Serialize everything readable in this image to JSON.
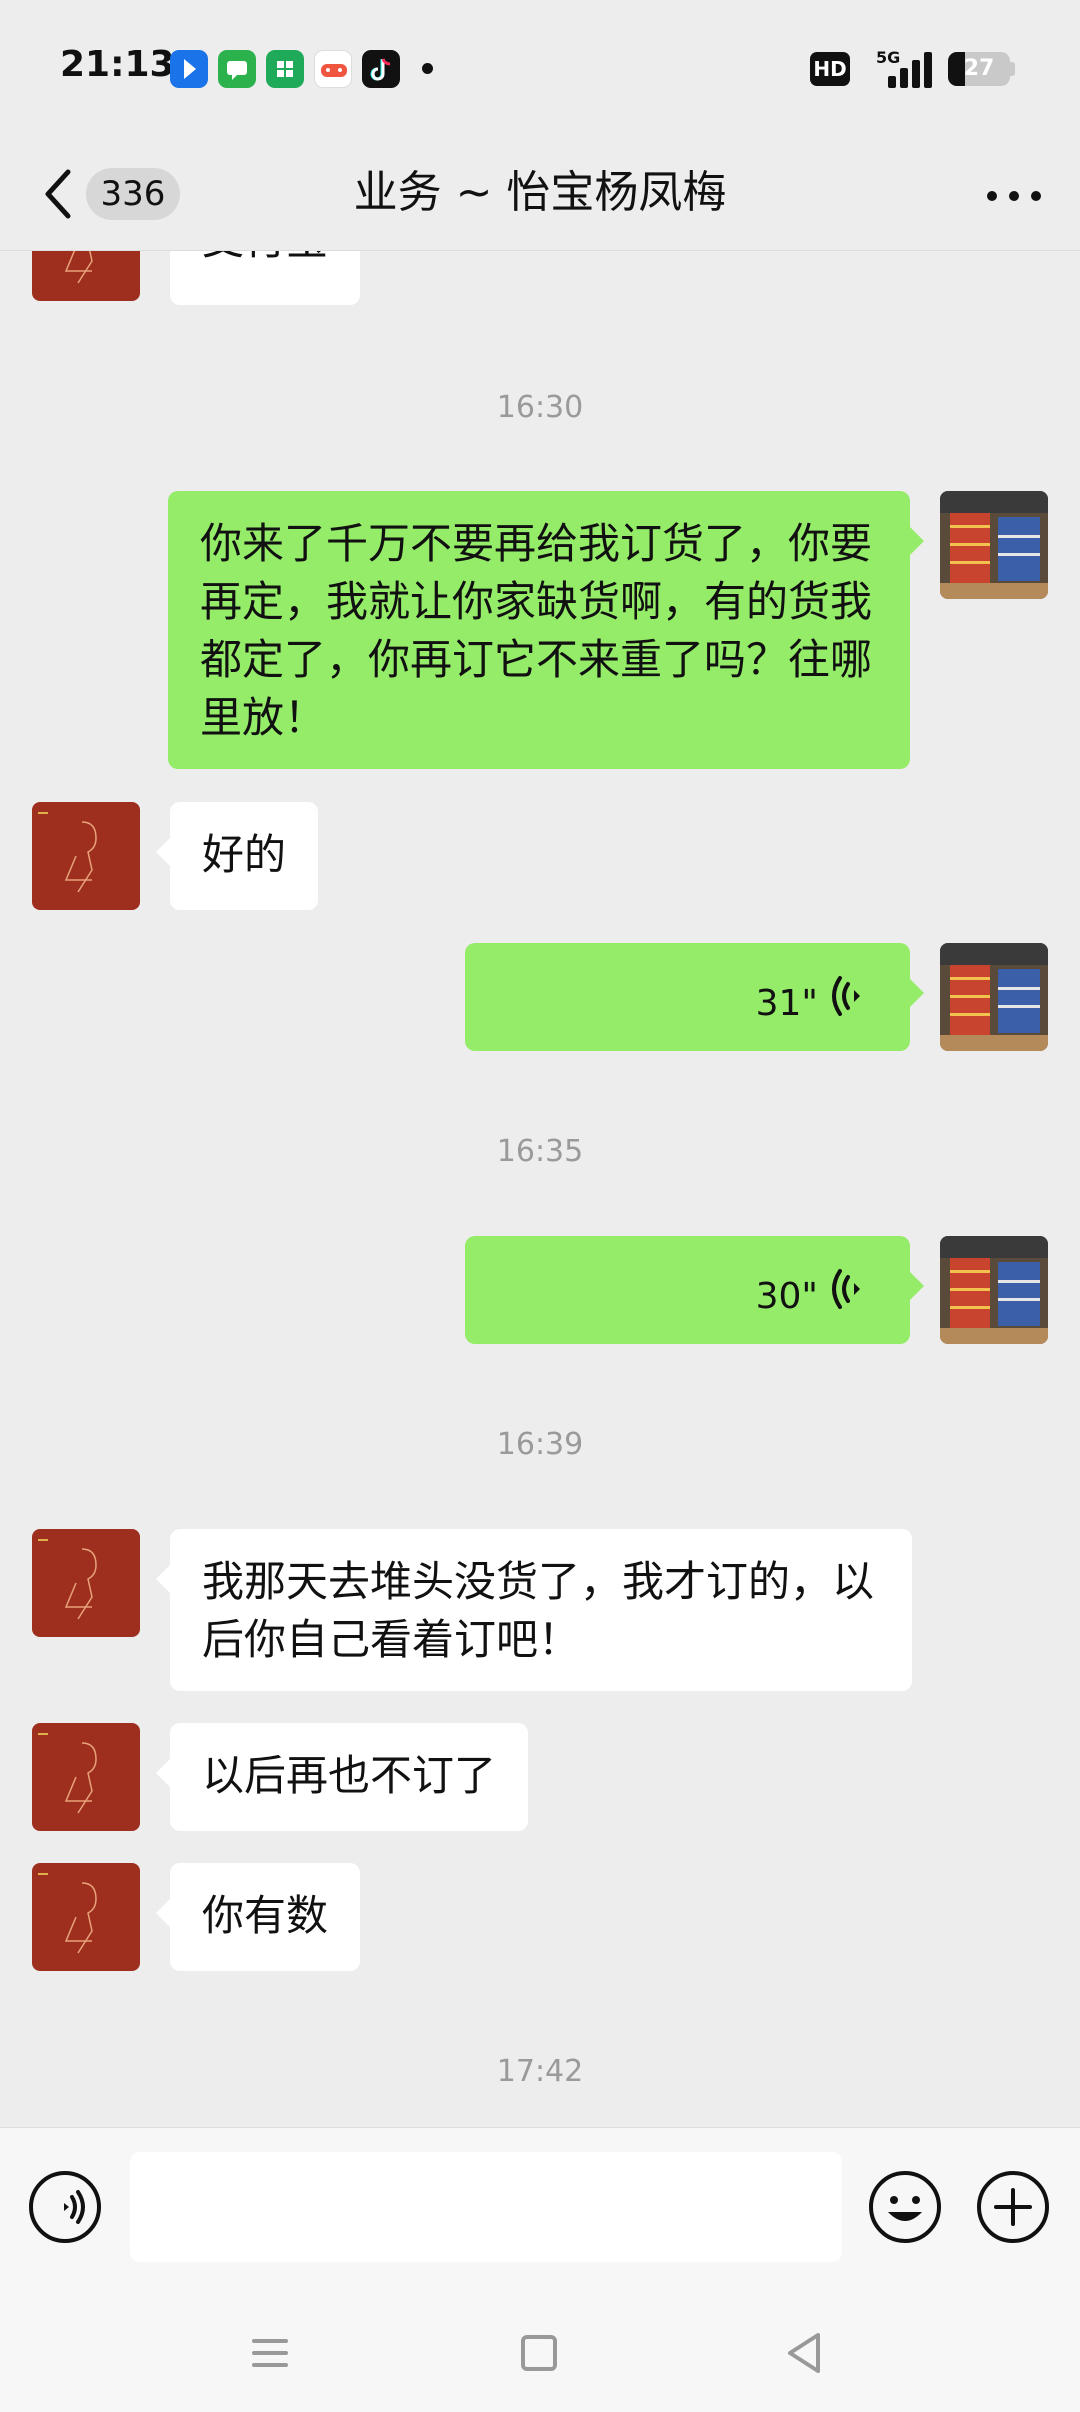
{
  "status_bar": {
    "time": "21:13",
    "network": "5G",
    "hd_label": "HD",
    "battery": "27",
    "battery_level": 0.27,
    "notification_icons": [
      "maps-icon",
      "messages-icon",
      "store-icon",
      "game-icon",
      "tiktok-icon"
    ]
  },
  "header": {
    "unread_count": "336",
    "title": "业务 ~ 怡宝杨凤梅"
  },
  "messages": [
    {
      "type": "text",
      "side": "in",
      "text": "支付宝"
    },
    {
      "type": "timestamp",
      "text": "16:30"
    },
    {
      "type": "text",
      "side": "out",
      "text": "你来了千万不要再给我订货了，你要再定，我就让你家缺货啊，有的货我都定了，你再订它不来重了吗？往哪里放！"
    },
    {
      "type": "text",
      "side": "in",
      "text": "好的"
    },
    {
      "type": "voice",
      "side": "out",
      "duration": "31\""
    },
    {
      "type": "timestamp",
      "text": "16:35"
    },
    {
      "type": "voice",
      "side": "out",
      "duration": "30\""
    },
    {
      "type": "timestamp",
      "text": "16:39"
    },
    {
      "type": "text",
      "side": "in",
      "text": "我那天去堆头没货了，我才订的，以后你自己看着订吧！"
    },
    {
      "type": "text",
      "side": "in",
      "text": "以后再也不订了"
    },
    {
      "type": "text",
      "side": "in",
      "text": "你有数"
    },
    {
      "type": "timestamp",
      "text": "17:42"
    }
  ],
  "input_bar": {
    "value": ""
  },
  "colors": {
    "outgoing_bubble": "#95ec69",
    "incoming_bubble": "#ffffff",
    "background": "#ededed"
  }
}
